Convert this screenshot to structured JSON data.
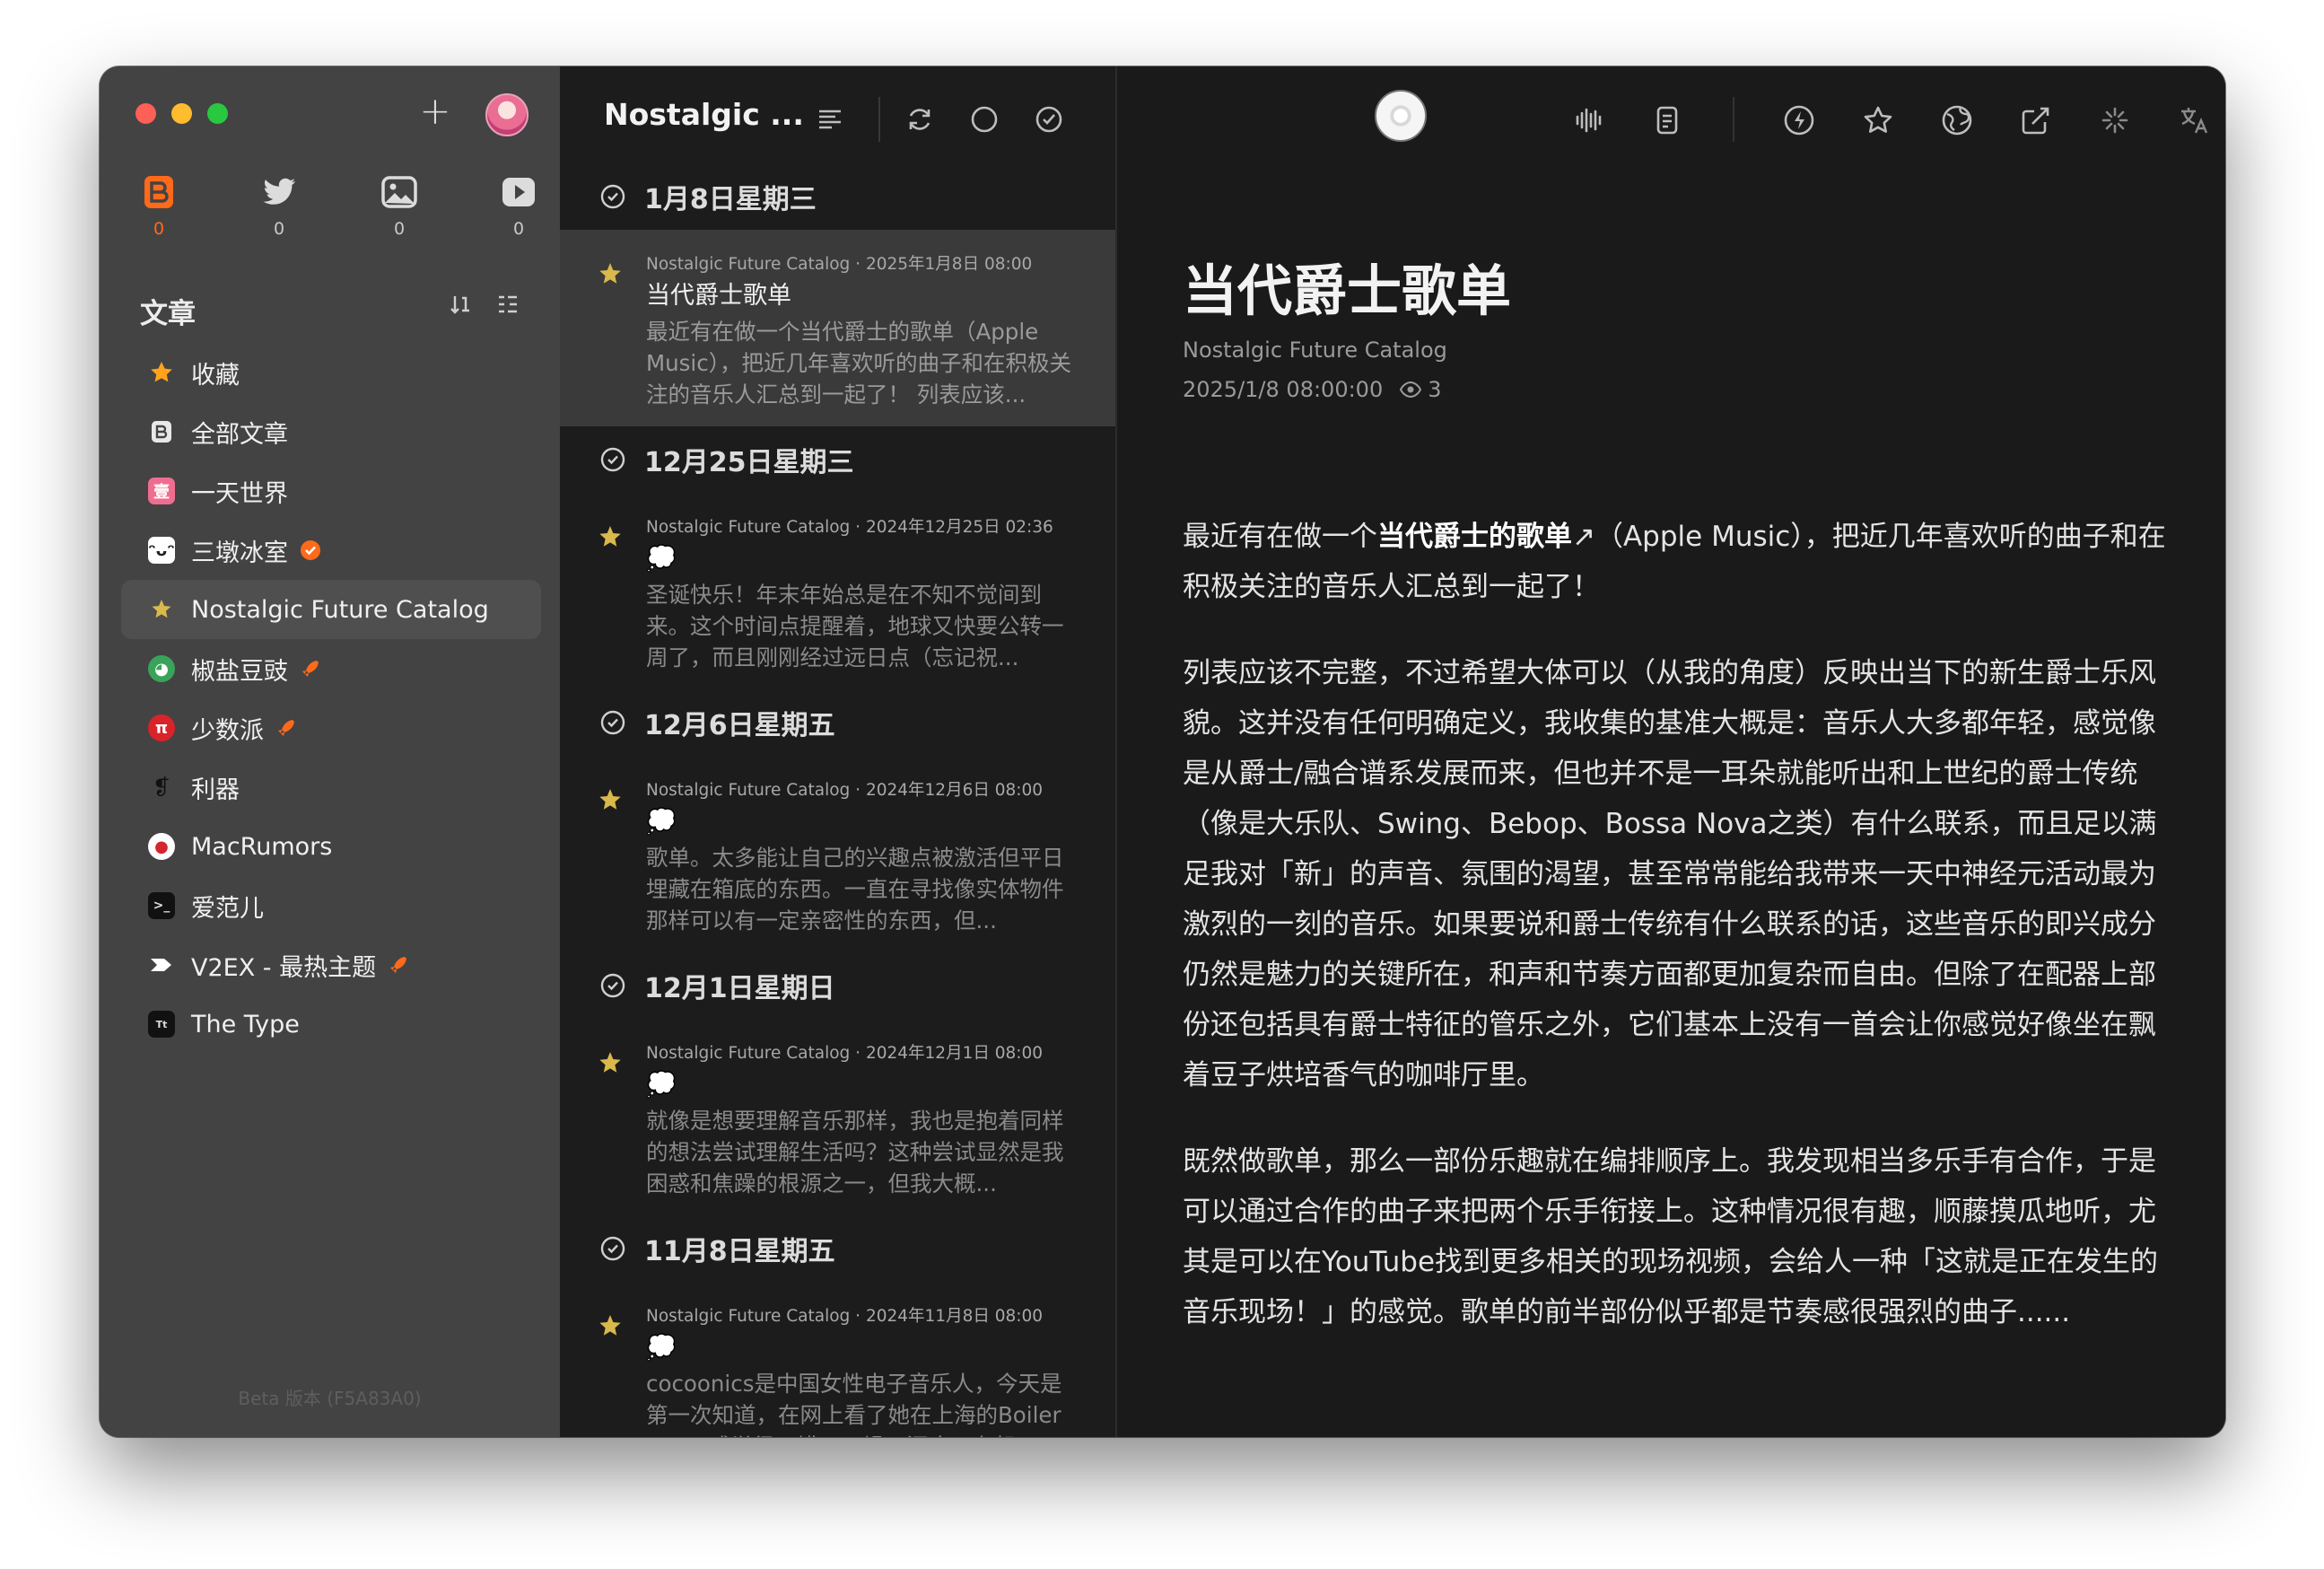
{
  "sidebar": {
    "sources": [
      {
        "icon": "reeder-icon",
        "count": "0"
      },
      {
        "icon": "twitter-icon",
        "count": "0"
      },
      {
        "icon": "photo-icon",
        "count": "0"
      },
      {
        "icon": "video-icon",
        "count": "0"
      }
    ],
    "section_title": "文章",
    "feeds": [
      {
        "label": "收藏",
        "icon": "star-icon"
      },
      {
        "label": "全部文章",
        "icon": "reeder-icon"
      },
      {
        "label": "一天世界",
        "icon": "feed-icon"
      },
      {
        "label": "三墩冰室",
        "icon": "feed-icon"
      },
      {
        "label": "Nostalgic Future Catalog",
        "icon": "feed-icon"
      },
      {
        "label": "椒盐豆豉",
        "icon": "feed-icon"
      },
      {
        "label": "少数派",
        "icon": "feed-icon"
      },
      {
        "label": "利器",
        "icon": "feed-icon"
      },
      {
        "label": "MacRumors",
        "icon": "feed-icon"
      },
      {
        "label": "爱范儿",
        "icon": "feed-icon"
      },
      {
        "label": "V2EX - 最热主题",
        "icon": "feed-icon"
      },
      {
        "label": "The Type",
        "icon": "feed-icon"
      }
    ],
    "beta_label": "Beta 版本 (F5A83A0)"
  },
  "list": {
    "title": "Nostalgic ...",
    "groups": [
      {
        "date": "1月8日星期三",
        "meta": "Nostalgic Future Catalog · 2025年1月8日 08:00",
        "title": "当代爵士歌单",
        "excerpt": "最近有在做一个当代爵士的歌单（Apple Music），把近几年喜欢听的曲子和在积极关注的音乐人汇总到一起了！ 列表应该..."
      },
      {
        "date": "12月25日星期三",
        "meta": "Nostalgic Future Catalog · 2024年12月25日 02:36",
        "title": "💭",
        "excerpt": "圣诞快乐！年末年始总是在不知不觉间到来。这个时间点提醒着，地球又快要公转一周了，而且刚刚经过远日点（忘记祝..."
      },
      {
        "date": "12月6日星期五",
        "meta": "Nostalgic Future Catalog · 2024年12月6日 08:00",
        "title": "💭",
        "excerpt": "歌单。太多能让自己的兴趣点被激活但平日埋藏在箱底的东西。一直在寻找像实体物件那样可以有一定亲密性的东西，但..."
      },
      {
        "date": "12月1日星期日",
        "meta": "Nostalgic Future Catalog · 2024年12月1日 08:00",
        "title": "💭",
        "excerpt": "就像是想要理解音乐那样，我也是抱着同样的想法尝试理解生活吗？这种尝试显然是我困惑和焦躁的根源之一，但我大概..."
      },
      {
        "date": "11月8日星期五",
        "meta": "Nostalgic Future Catalog · 2024年11月8日 08:00",
        "title": "💭",
        "excerpt": "cocoonics是中国女性电子音乐人，今天是第一次知道，在网上看了她在上海的Boiler Room感觉很不错，干燥、深度、有机..."
      }
    ]
  },
  "article": {
    "title": "当代爵士歌单",
    "source": "Nostalgic Future Catalog",
    "date": "2025/1/8 08:00:00",
    "views": "3",
    "p1_pre": "最近有在做一个",
    "p1_link": "当代爵士的歌单",
    "p1_post": "↗（Apple Music），把近几年喜欢听的曲子和在积极关注的音乐人汇总到一起了！",
    "p2": "列表应该不完整，不过希望大体可以（从我的角度）反映出当下的新生爵士乐风貌。这并没有任何明确定义，我收集的基准大概是：音乐人大多都年轻，感觉像是从爵士/融合谱系发展而来，但也并不是一耳朵就能听出和上世纪的爵士传统（像是大乐队、Swing、Bebop、Bossa Nova之类）有什么联系，而且足以满足我对「新」的声音、氛围的渴望，甚至常常能给我带来一天中神经元活动最为激烈的一刻的音乐。如果要说和爵士传统有什么联系的话，这些音乐的即兴成分仍然是魅力的关键所在，和声和节奏方面都更加复杂而自由。但除了在配器上部份还包括具有爵士特征的管乐之外，它们基本上没有一首会让你感觉好像坐在飘着豆子烘培香气的咖啡厅里。",
    "p3": "既然做歌单，那么一部份乐趣就在编排顺序上。我发现相当多乐手有合作，于是可以通过合作的曲子来把两个乐手衔接上。这种情况很有趣，顺藤摸瓜地听，尤其是可以在YouTube找到更多相关的现场视频，会给人一种「这就是正在发生的音乐现场！」的感觉。歌单的前半部份似乎都是节奏感很强烈的曲子......"
  },
  "colors": {
    "accent": "#ff6a1a",
    "sidebar": "#434343",
    "list": "#1c1c1c",
    "reader": "#1a1a1a"
  }
}
